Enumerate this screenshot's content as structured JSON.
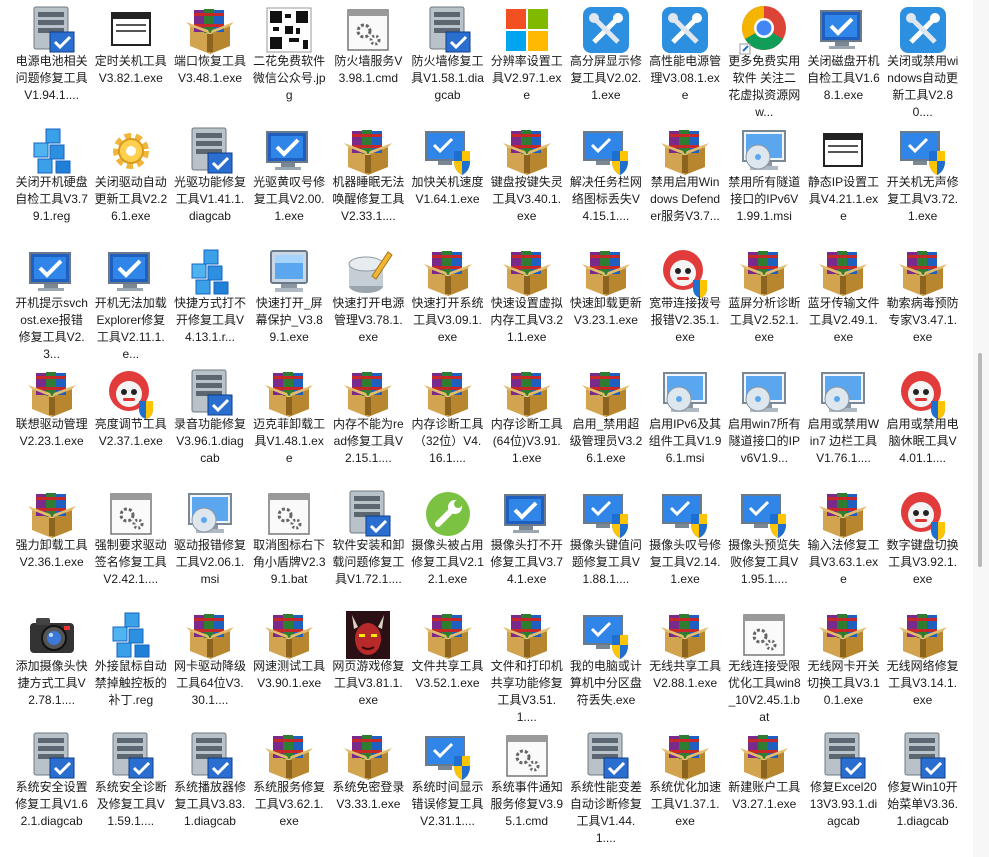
{
  "colors": {
    "background": "#ffffff",
    "text": "#1a1a1a",
    "scroll_thumb": "#b9b9b9"
  },
  "files": [
    {
      "label": "电源电池相关问题修复工具V1.94.1....",
      "icon": "server-icon"
    },
    {
      "label": "定时关机工具V3.82.1.exe",
      "icon": "exe-window-icon"
    },
    {
      "label": "端口恢复工具V3.48.1.exe",
      "icon": "winrar-icon"
    },
    {
      "label": "二花免费软件微信公众号.jpg",
      "icon": "qr-icon"
    },
    {
      "label": "防火墙服务V3.98.1.cmd",
      "icon": "cmd-gear-icon"
    },
    {
      "label": "防火墙修复工具V1.58.1.diagcab",
      "icon": "server-icon"
    },
    {
      "label": "分辨率设置工具V2.97.1.exe",
      "icon": "windows-logo-icon"
    },
    {
      "label": "高分屏显示修复工具V2.02.1.exe",
      "icon": "tools-icon"
    },
    {
      "label": "高性能电源管理V3.08.1.exe",
      "icon": "tools-icon"
    },
    {
      "label": "更多免费实用软件 关注二花虚拟资源网 w...",
      "icon": "chrome-icon"
    },
    {
      "label": "关闭磁盘开机自检工具V1.68.1.exe",
      "icon": "monitor-check-icon"
    },
    {
      "label": "关闭或禁用windows自动更新工具V2.80....",
      "icon": "tools-icon"
    },
    {
      "label": "关闭开机硬盘自检工具V3.79.1.reg",
      "icon": "reg-icon"
    },
    {
      "label": "关闭驱动自动更新工具V2.26.1.exe",
      "icon": "gear-icon"
    },
    {
      "label": "光驱功能修复工具V1.41.1.diagcab",
      "icon": "server-icon"
    },
    {
      "label": "光驱黄叹号修复工具V2.00.1.exe",
      "icon": "monitor-check-icon"
    },
    {
      "label": "机器睡眠无法唤醒修复工具V2.33.1....",
      "icon": "winrar-icon"
    },
    {
      "label": "加快关机速度V1.64.1.exe",
      "icon": "monitor-shield-icon"
    },
    {
      "label": "键盘按键失灵工具V3.40.1.exe",
      "icon": "winrar-icon"
    },
    {
      "label": "解决任务栏网络图标丢失V4.15.1....",
      "icon": "monitor-shield-icon"
    },
    {
      "label": "禁用启用Windows Defender服务V3.7...",
      "icon": "winrar-icon"
    },
    {
      "label": "禁用所有隧道接口的IPv6V1.99.1.msi",
      "icon": "disc-monitor-icon"
    },
    {
      "label": "静态IP设置工具V4.21.1.exe",
      "icon": "exe-window-icon"
    },
    {
      "label": "开关机无声修复工具V3.72.1.exe",
      "icon": "monitor-shield-icon"
    },
    {
      "label": "开机提示svchost.exe报错修复工具V2.3...",
      "icon": "monitor-check-icon"
    },
    {
      "label": "开机无法加载Explorer修复工具V2.11.1.e...",
      "icon": "monitor-check-icon"
    },
    {
      "label": "快捷方式打不开修复工具V4.13.1.r...",
      "icon": "reg-icon"
    },
    {
      "label": "快速打开_屏幕保护_V3.89.1.exe",
      "icon": "screen-icon"
    },
    {
      "label": "快速打开电源管理V3.78.1.exe",
      "icon": "pen-disk-icon"
    },
    {
      "label": "快速打开系统工具V3.09.1.exe",
      "icon": "winrar-icon"
    },
    {
      "label": "快速设置虚拟内存工具V3.21.1.exe",
      "icon": "winrar-icon"
    },
    {
      "label": "快速卸载更新V3.23.1.exe",
      "icon": "winrar-icon"
    },
    {
      "label": "宽带连接拨号报错V2.35.1.exe",
      "icon": "robot-icon"
    },
    {
      "label": "蓝屏分析诊断工具V2.52.1.exe",
      "icon": "winrar-icon"
    },
    {
      "label": "蓝牙传输文件工具V2.49.1.exe",
      "icon": "winrar-icon"
    },
    {
      "label": "勒索病毒预防专家V3.47.1.exe",
      "icon": "winrar-icon"
    },
    {
      "label": "联想驱动管理V2.23.1.exe",
      "icon": "winrar-icon"
    },
    {
      "label": "亮度调节工具V2.37.1.exe",
      "icon": "robot-icon"
    },
    {
      "label": "录音功能修复V3.96.1.diagcab",
      "icon": "server-icon"
    },
    {
      "label": "迈克菲卸载工具V1.48.1.exe",
      "icon": "winrar-icon"
    },
    {
      "label": "内存不能为read修复工具V2.15.1....",
      "icon": "winrar-icon"
    },
    {
      "label": "内存诊断工具（32位）V4.16.1....",
      "icon": "winrar-icon"
    },
    {
      "label": "内存诊断工具(64位)V3.91.1.exe",
      "icon": "winrar-icon"
    },
    {
      "label": "启用_禁用超级管理员V3.26.1.exe",
      "icon": "winrar-icon"
    },
    {
      "label": "启用IPv6及其组件工具V1.96.1.msi",
      "icon": "disc-monitor-icon"
    },
    {
      "label": "启用win7所有隧道接口的IPv6V1.9...",
      "icon": "disc-monitor-icon"
    },
    {
      "label": "启用或禁用Win7 边栏工具V1.76.1....",
      "icon": "disc-monitor-icon"
    },
    {
      "label": "启用或禁用电脑休眠工具V4.01.1....",
      "icon": "robot-icon"
    },
    {
      "label": "强力卸载工具V2.36.1.exe",
      "icon": "winrar-icon"
    },
    {
      "label": "强制要求驱动签名修复工具V2.42.1....",
      "icon": "cmd-gear-icon"
    },
    {
      "label": "驱动报错修复工具V2.06.1.msi",
      "icon": "disc-monitor-icon"
    },
    {
      "label": "取消图标右下角小盾牌V2.39.1.bat",
      "icon": "cmd-gear-icon"
    },
    {
      "label": "软件安装和卸载问题修复工具V1.72.1....",
      "icon": "server-icon"
    },
    {
      "label": "摄像头被占用修复工具V2.12.1.exe",
      "icon": "wrench-circle-icon"
    },
    {
      "label": "摄像头打不开修复工具V3.74.1.exe",
      "icon": "monitor-check-icon"
    },
    {
      "label": "摄像头键值问题修复工具V1.88.1....",
      "icon": "monitor-shield-icon"
    },
    {
      "label": "摄像头叹号修复工具V2.14.1.exe",
      "icon": "monitor-shield-icon"
    },
    {
      "label": "摄像头预览失败修复工具V1.95.1....",
      "icon": "monitor-shield-icon"
    },
    {
      "label": "输入法修复工具V3.63.1.exe",
      "icon": "winrar-icon"
    },
    {
      "label": "数字键盘切换工具V3.92.1.exe",
      "icon": "robot-icon"
    },
    {
      "label": "添加摄像头快捷方式工具V2.78.1....",
      "icon": "camera-icon"
    },
    {
      "label": "外接鼠标自动禁掉触控板的补丁.reg",
      "icon": "reg-icon"
    },
    {
      "label": "网卡驱动降级工具64位V3.30.1....",
      "icon": "winrar-icon"
    },
    {
      "label": "网速测试工具V3.90.1.exe",
      "icon": "winrar-icon"
    },
    {
      "label": "网页游戏修复工具V3.81.1.exe",
      "icon": "demon-icon"
    },
    {
      "label": "文件共享工具V3.52.1.exe",
      "icon": "winrar-icon"
    },
    {
      "label": "文件和打印机共享功能修复工具V3.51.1....",
      "icon": "winrar-icon"
    },
    {
      "label": "我的电脑或计算机中分区盘符丢失.exe",
      "icon": "monitor-shield-icon"
    },
    {
      "label": "无线共享工具V2.88.1.exe",
      "icon": "winrar-icon"
    },
    {
      "label": "无线连接受限优化工具win8_10V2.45.1.bat",
      "icon": "cmd-gear-icon"
    },
    {
      "label": "无线网卡开关切换工具V3.10.1.exe",
      "icon": "winrar-icon"
    },
    {
      "label": "无线网络修复工具V3.14.1.exe",
      "icon": "winrar-icon"
    },
    {
      "label": "系统安全设置修复工具V1.62.1.diagcab",
      "icon": "server-icon"
    },
    {
      "label": "系统安全诊断及修复工具V1.59.1....",
      "icon": "server-icon"
    },
    {
      "label": "系统播放器修复工具V3.83.1.diagcab",
      "icon": "server-icon"
    },
    {
      "label": "系统服务修复工具V3.62.1.exe",
      "icon": "winrar-icon"
    },
    {
      "label": "系统免密登录V3.33.1.exe",
      "icon": "winrar-icon"
    },
    {
      "label": "系统时间显示错误修复工具V2.31.1....",
      "icon": "monitor-shield-icon"
    },
    {
      "label": "系统事件通知服务修复V3.95.1.cmd",
      "icon": "cmd-gear-icon"
    },
    {
      "label": "系统性能变差自动诊断修复工具V1.44.1....",
      "icon": "server-icon"
    },
    {
      "label": "系统优化加速工具V1.37.1.exe",
      "icon": "winrar-icon"
    },
    {
      "label": "新建账户工具V3.27.1.exe",
      "icon": "winrar-icon"
    },
    {
      "label": "修复Excel2013V3.93.1.diagcab",
      "icon": "server-icon"
    },
    {
      "label": "修复Win10开始菜单V3.36.1.diagcab",
      "icon": "server-icon"
    }
  ]
}
